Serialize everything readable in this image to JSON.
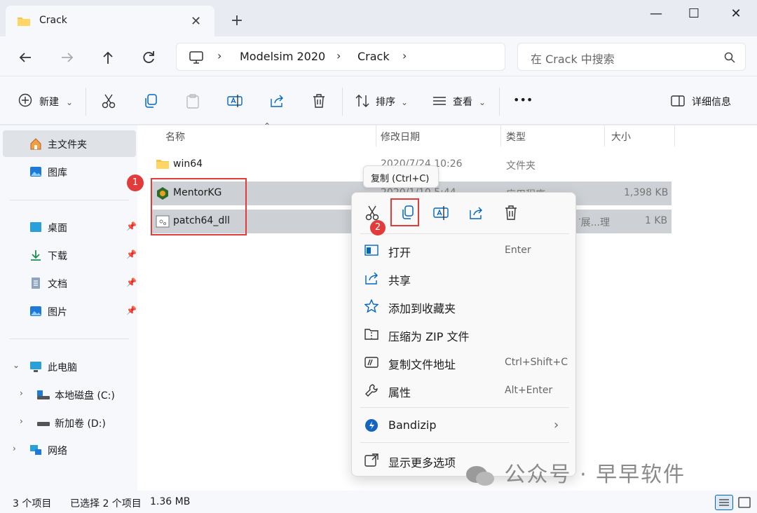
{
  "window": {
    "tab_title": "Crack",
    "new_tab": "+",
    "controls": {
      "minimize": "—",
      "maximize": "☐",
      "close": "✕"
    }
  },
  "address": {
    "crumbs": [
      "Modelsim 2020",
      "Crack"
    ],
    "search_placeholder": "在 Crack 中搜索"
  },
  "toolbar": {
    "new_label": "新建",
    "sort_label": "排序",
    "view_label": "查看",
    "more_label": "•••",
    "details_label": "详细信息"
  },
  "sidebar": {
    "home": "主文件夹",
    "gallery": "图库",
    "desktop": "桌面",
    "downloads": "下载",
    "documents": "文档",
    "pictures": "图片",
    "this_pc": "此电脑",
    "drive_c": "本地磁盘 (C:)",
    "drive_d": "新加卷 (D:)",
    "network": "网络"
  },
  "columns": {
    "name": "名称",
    "modified": "修改日期",
    "type": "类型",
    "size": "大小"
  },
  "files": [
    {
      "name": "win64",
      "modified": "2020/7/24 10:26",
      "type": "文件夹",
      "size": ""
    },
    {
      "name": "MentorKG",
      "modified": "2020/1/10 5:44",
      "type": "应用程序",
      "size": "1,398 KB"
    },
    {
      "name": "patch64_dll",
      "modified": "",
      "type": "应用程序扩展...理...",
      "size": "1 KB"
    }
  ],
  "annotations": {
    "badge1": "1",
    "badge2": "2"
  },
  "tooltip": "复制 (Ctrl+C)",
  "context_menu": {
    "open": {
      "label": "打开",
      "shortcut": "Enter"
    },
    "share": {
      "label": "共享"
    },
    "favorite": {
      "label": "添加到收藏夹"
    },
    "zip": {
      "label": "压缩为 ZIP 文件"
    },
    "copy_path": {
      "label": "复制文件地址",
      "shortcut": "Ctrl+Shift+C"
    },
    "properties": {
      "label": "属性",
      "shortcut": "Alt+Enter"
    },
    "bandizip": {
      "label": "Bandizip"
    },
    "more": {
      "label": "显示更多选项"
    }
  },
  "status": {
    "count": "3 个项目",
    "selected": "已选择 2 个项目",
    "size": "1.36 MB"
  },
  "watermark": "公众号 · 早早软件",
  "colors": {
    "accent": "#0067c0",
    "annotation_red": "#e23b3b",
    "folder": "#f4c542"
  }
}
